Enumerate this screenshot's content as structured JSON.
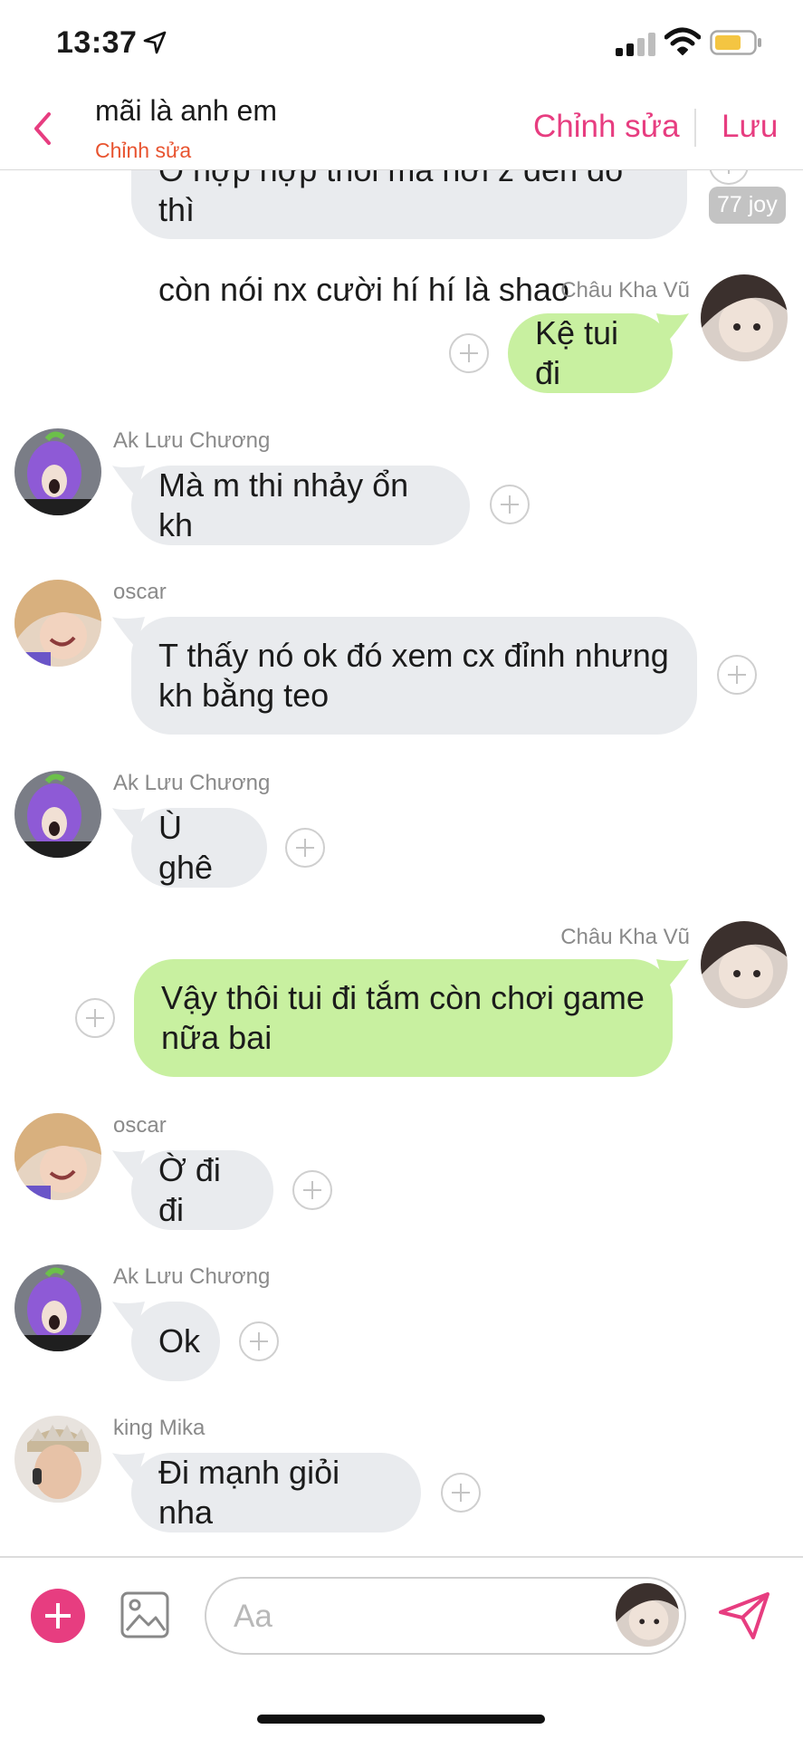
{
  "status_bar": {
    "time": "13:37",
    "battery_color": "#f4c542"
  },
  "header": {
    "title": "mãi là anh em",
    "subtitle": "Chỉnh sửa",
    "edit_label": "Chỉnh sửa",
    "save_label": "Lưu",
    "accent_color": "#e73d80"
  },
  "partial_message": {
    "text_top": "Ô hợp hợp thôi mà hơi z đến đó thì",
    "text": "còn nói nx cười hí hí là shao",
    "reaction": "77 joy"
  },
  "messages": [
    {
      "sender": "Châu Kha Vũ",
      "text": "Kệ tui đi",
      "direction": "out",
      "avatar": "avatar-chau-kha-vu"
    },
    {
      "sender": "Ak Lưu Chương",
      "text": "Mà m thi nhảy ổn kh",
      "direction": "in",
      "avatar": "avatar-ak-luu-chuong"
    },
    {
      "sender": "oscar",
      "text": "T thấy nó ok đó xem cx đỉnh nhưng\nkh bằng teo",
      "direction": "in",
      "avatar": "avatar-oscar"
    },
    {
      "sender": "Ak Lưu Chương",
      "text": "Ù ghê",
      "direction": "in",
      "avatar": "avatar-ak-luu-chuong"
    },
    {
      "sender": "Châu Kha Vũ",
      "text": "Vậy thôi tui đi tắm còn chơi game\nnữa bai",
      "direction": "out",
      "avatar": "avatar-chau-kha-vu"
    },
    {
      "sender": "oscar",
      "text": "Ờ đi đi",
      "direction": "in",
      "avatar": "avatar-oscar"
    },
    {
      "sender": "Ak Lưu Chương",
      "text": "Ok",
      "direction": "in",
      "avatar": "avatar-ak-luu-chuong"
    },
    {
      "sender": "king Mika",
      "text": "Đi mạnh giỏi nha",
      "direction": "in",
      "avatar": "avatar-king-mika"
    }
  ],
  "composer": {
    "placeholder": "Aa"
  },
  "colors": {
    "incoming_bubble": "#e9ebee",
    "outgoing_bubble": "#c8f0a0",
    "accent": "#e73d80"
  }
}
